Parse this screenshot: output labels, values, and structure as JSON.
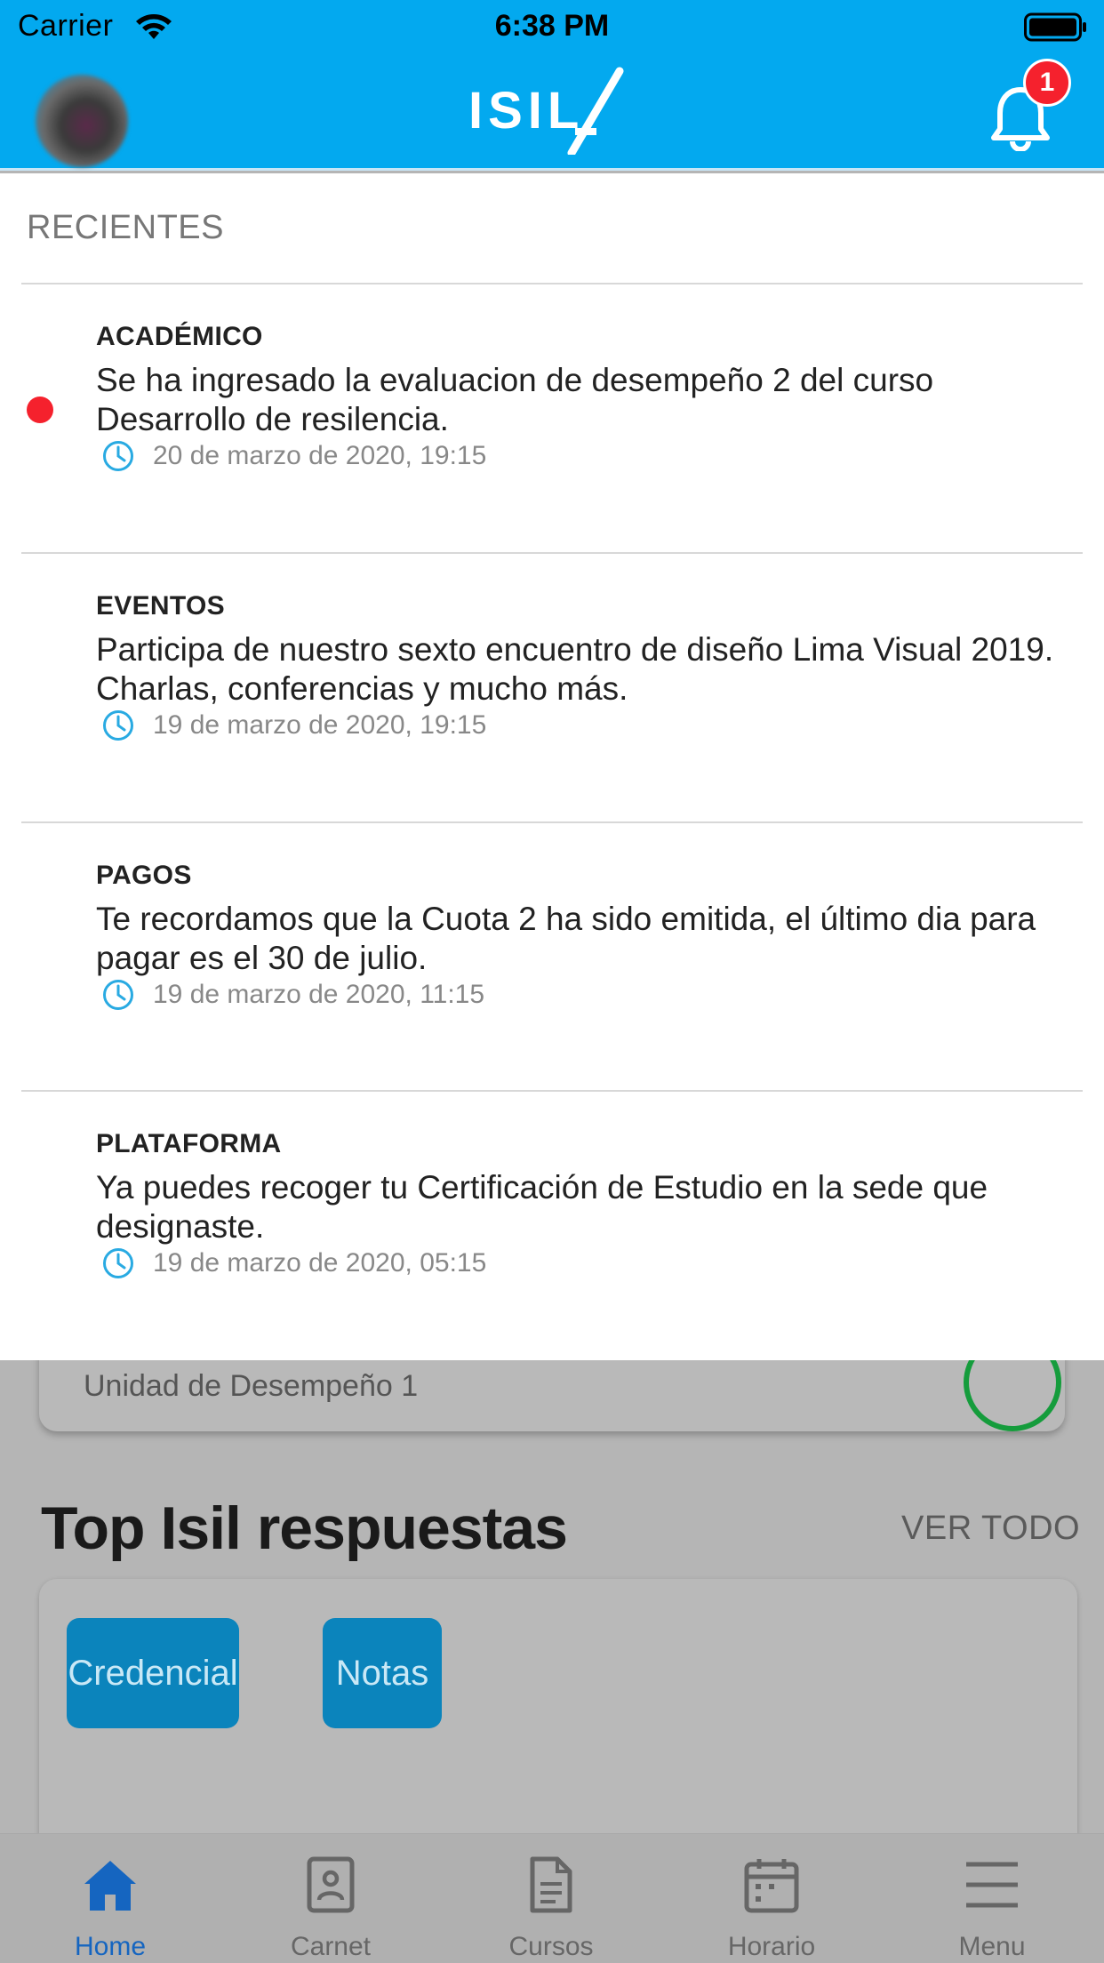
{
  "status_bar": {
    "carrier": "Carrier",
    "time": "6:38 PM"
  },
  "header": {
    "logo_text": "ISIL",
    "notification_count": "1",
    "brand_color": "#03a9ef"
  },
  "notifications": {
    "section_title": "RECIENTES",
    "items": [
      {
        "category": "ACADÉMICO",
        "message": "Se ha ingresado la evaluacion de desempeño 2 del curso Desarrollo de resilencia.",
        "time": "20 de marzo de 2020, 19:15",
        "unread": true
      },
      {
        "category": "EVENTOS",
        "message": "Participa de nuestro sexto encuentro de diseño Lima Visual 2019. Charlas, conferencias y mucho más.",
        "time": "19 de marzo de 2020, 19:15",
        "unread": false
      },
      {
        "category": "PAGOS",
        "message": "Te recordamos que la Cuota 2 ha sido emitida, el último dia para pagar es el 30 de julio.",
        "time": "19 de marzo de 2020, 11:15",
        "unread": false
      },
      {
        "category": "PLATAFORMA",
        "message": "Ya puedes recoger tu Certificación de Estudio en la sede que designaste.",
        "time": "19 de marzo de 2020, 05:15",
        "unread": false
      }
    ]
  },
  "background_page": {
    "card_partial_text": "Unidad de Desempeño 1",
    "top_title": "Top Isil respuestas",
    "ver_todo": "VER TODO",
    "answer_buttons": [
      "Credencial",
      "Notas"
    ]
  },
  "tabbar": {
    "items": [
      {
        "label": "Home",
        "icon": "home-icon",
        "active": true
      },
      {
        "label": "Carnet",
        "icon": "id-card-icon",
        "active": false
      },
      {
        "label": "Cursos",
        "icon": "document-icon",
        "active": false
      },
      {
        "label": "Horario",
        "icon": "calendar-icon",
        "active": false
      },
      {
        "label": "Menu",
        "icon": "hamburger-icon",
        "active": false
      }
    ]
  }
}
